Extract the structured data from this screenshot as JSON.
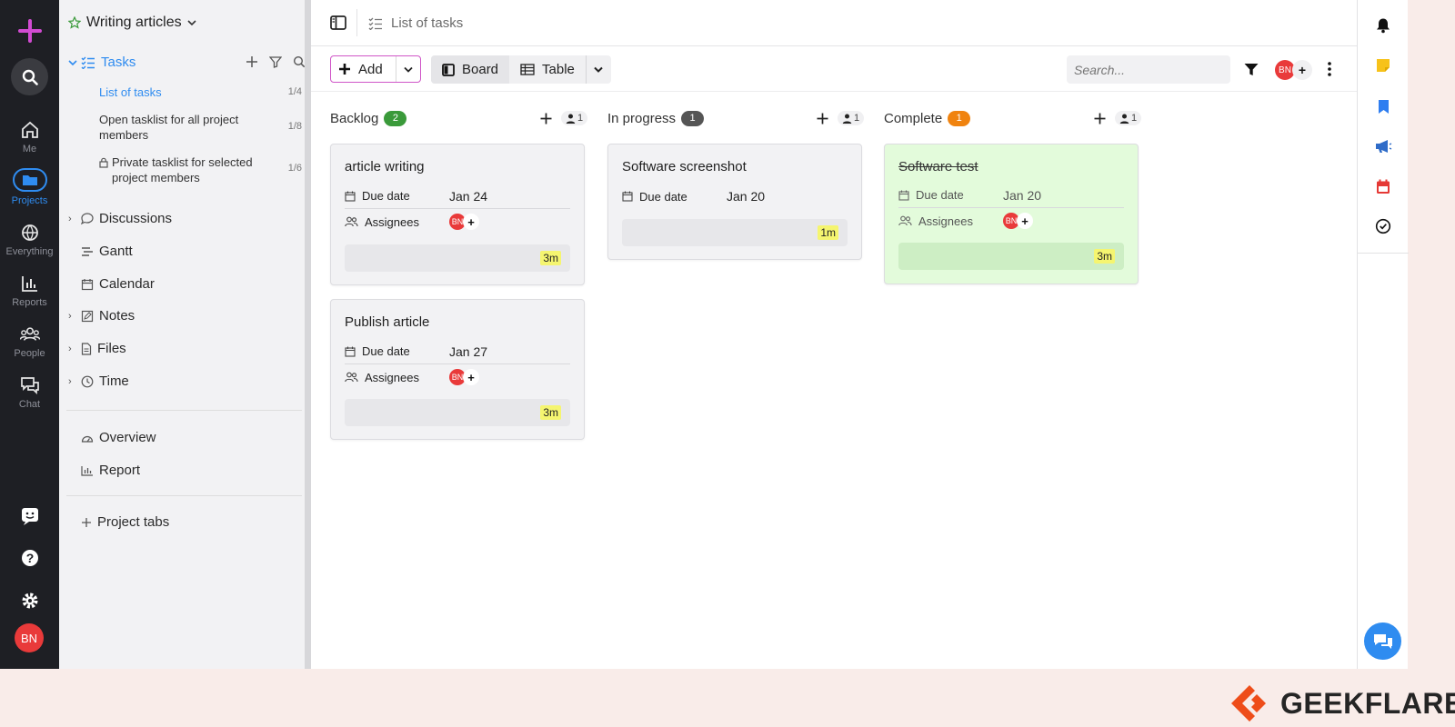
{
  "sidebar": {
    "project_title": "Writing articles",
    "tasks_label": "Tasks",
    "tasklists": [
      {
        "label": "List of tasks",
        "count": "1/4"
      },
      {
        "label": "Open tasklist for all project members",
        "count": "1/8"
      },
      {
        "label": "Private tasklist for selected project members",
        "count": "1/6"
      }
    ],
    "sections": [
      "Discussions",
      "Gantt",
      "Calendar",
      "Notes",
      "Files",
      "Time"
    ],
    "extra": [
      "Overview",
      "Report"
    ],
    "project_tabs": "Project tabs"
  },
  "rail": {
    "items": [
      "Me",
      "Projects",
      "Everything",
      "Reports",
      "People",
      "Chat"
    ],
    "user_initials": "BN"
  },
  "header": {
    "breadcrumb": "List of tasks"
  },
  "toolbar": {
    "add_label": "Add",
    "board_label": "Board",
    "table_label": "Table",
    "search_placeholder": "Search...",
    "user_initials": "BN"
  },
  "board": {
    "columns": [
      {
        "name": "Backlog",
        "count": "2",
        "members": "1",
        "color": "#3a9a3a"
      },
      {
        "name": "In progress",
        "count": "1",
        "members": "1",
        "color": "#555555"
      },
      {
        "name": "Complete",
        "count": "1",
        "members": "1",
        "color": "#f0830f"
      }
    ],
    "cards": [
      {
        "title": "article writing",
        "due_label": "Due date",
        "due": "Jan 24",
        "assignees_label": "Assignees",
        "assignee": "BN",
        "time": "3m"
      },
      {
        "title": "Publish article",
        "due_label": "Due date",
        "due": "Jan 27",
        "assignees_label": "Assignees",
        "assignee": "BN",
        "time": "3m"
      },
      {
        "title": "Software screenshot",
        "due_label": "Due date",
        "due": "Jan 20",
        "time": "1m"
      },
      {
        "title": "Software test",
        "due_label": "Due date",
        "due": "Jan 20",
        "assignees_label": "Assignees",
        "assignee": "BN",
        "time": "3m"
      }
    ]
  },
  "watermark": {
    "brand": "GEEKFLARE"
  },
  "colors": {
    "accent": "#2f8cf0",
    "add_border": "#d056c8",
    "complete_card": "#e3fbdb"
  }
}
